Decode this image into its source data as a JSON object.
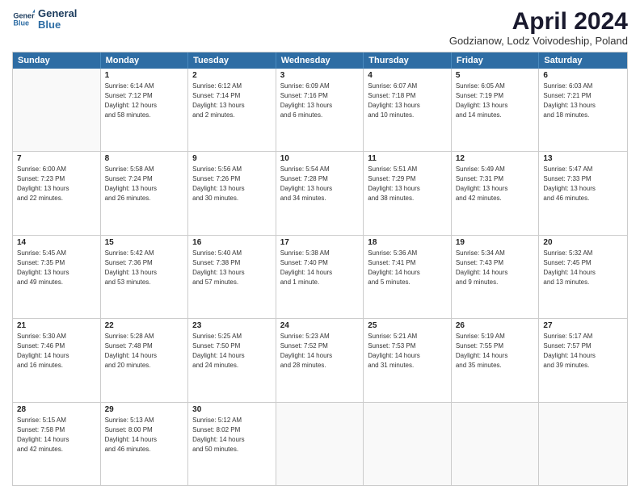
{
  "logo": {
    "line1": "General",
    "line2": "Blue"
  },
  "title": "April 2024",
  "subtitle": "Godzianow, Lodz Voivodeship, Poland",
  "days": [
    "Sunday",
    "Monday",
    "Tuesday",
    "Wednesday",
    "Thursday",
    "Friday",
    "Saturday"
  ],
  "weeks": [
    [
      {
        "day": "",
        "info": ""
      },
      {
        "day": "1",
        "info": "Sunrise: 6:14 AM\nSunset: 7:12 PM\nDaylight: 12 hours\nand 58 minutes."
      },
      {
        "day": "2",
        "info": "Sunrise: 6:12 AM\nSunset: 7:14 PM\nDaylight: 13 hours\nand 2 minutes."
      },
      {
        "day": "3",
        "info": "Sunrise: 6:09 AM\nSunset: 7:16 PM\nDaylight: 13 hours\nand 6 minutes."
      },
      {
        "day": "4",
        "info": "Sunrise: 6:07 AM\nSunset: 7:18 PM\nDaylight: 13 hours\nand 10 minutes."
      },
      {
        "day": "5",
        "info": "Sunrise: 6:05 AM\nSunset: 7:19 PM\nDaylight: 13 hours\nand 14 minutes."
      },
      {
        "day": "6",
        "info": "Sunrise: 6:03 AM\nSunset: 7:21 PM\nDaylight: 13 hours\nand 18 minutes."
      }
    ],
    [
      {
        "day": "7",
        "info": "Sunrise: 6:00 AM\nSunset: 7:23 PM\nDaylight: 13 hours\nand 22 minutes."
      },
      {
        "day": "8",
        "info": "Sunrise: 5:58 AM\nSunset: 7:24 PM\nDaylight: 13 hours\nand 26 minutes."
      },
      {
        "day": "9",
        "info": "Sunrise: 5:56 AM\nSunset: 7:26 PM\nDaylight: 13 hours\nand 30 minutes."
      },
      {
        "day": "10",
        "info": "Sunrise: 5:54 AM\nSunset: 7:28 PM\nDaylight: 13 hours\nand 34 minutes."
      },
      {
        "day": "11",
        "info": "Sunrise: 5:51 AM\nSunset: 7:29 PM\nDaylight: 13 hours\nand 38 minutes."
      },
      {
        "day": "12",
        "info": "Sunrise: 5:49 AM\nSunset: 7:31 PM\nDaylight: 13 hours\nand 42 minutes."
      },
      {
        "day": "13",
        "info": "Sunrise: 5:47 AM\nSunset: 7:33 PM\nDaylight: 13 hours\nand 46 minutes."
      }
    ],
    [
      {
        "day": "14",
        "info": "Sunrise: 5:45 AM\nSunset: 7:35 PM\nDaylight: 13 hours\nand 49 minutes."
      },
      {
        "day": "15",
        "info": "Sunrise: 5:42 AM\nSunset: 7:36 PM\nDaylight: 13 hours\nand 53 minutes."
      },
      {
        "day": "16",
        "info": "Sunrise: 5:40 AM\nSunset: 7:38 PM\nDaylight: 13 hours\nand 57 minutes."
      },
      {
        "day": "17",
        "info": "Sunrise: 5:38 AM\nSunset: 7:40 PM\nDaylight: 14 hours\nand 1 minute."
      },
      {
        "day": "18",
        "info": "Sunrise: 5:36 AM\nSunset: 7:41 PM\nDaylight: 14 hours\nand 5 minutes."
      },
      {
        "day": "19",
        "info": "Sunrise: 5:34 AM\nSunset: 7:43 PM\nDaylight: 14 hours\nand 9 minutes."
      },
      {
        "day": "20",
        "info": "Sunrise: 5:32 AM\nSunset: 7:45 PM\nDaylight: 14 hours\nand 13 minutes."
      }
    ],
    [
      {
        "day": "21",
        "info": "Sunrise: 5:30 AM\nSunset: 7:46 PM\nDaylight: 14 hours\nand 16 minutes."
      },
      {
        "day": "22",
        "info": "Sunrise: 5:28 AM\nSunset: 7:48 PM\nDaylight: 14 hours\nand 20 minutes."
      },
      {
        "day": "23",
        "info": "Sunrise: 5:25 AM\nSunset: 7:50 PM\nDaylight: 14 hours\nand 24 minutes."
      },
      {
        "day": "24",
        "info": "Sunrise: 5:23 AM\nSunset: 7:52 PM\nDaylight: 14 hours\nand 28 minutes."
      },
      {
        "day": "25",
        "info": "Sunrise: 5:21 AM\nSunset: 7:53 PM\nDaylight: 14 hours\nand 31 minutes."
      },
      {
        "day": "26",
        "info": "Sunrise: 5:19 AM\nSunset: 7:55 PM\nDaylight: 14 hours\nand 35 minutes."
      },
      {
        "day": "27",
        "info": "Sunrise: 5:17 AM\nSunset: 7:57 PM\nDaylight: 14 hours\nand 39 minutes."
      }
    ],
    [
      {
        "day": "28",
        "info": "Sunrise: 5:15 AM\nSunset: 7:58 PM\nDaylight: 14 hours\nand 42 minutes."
      },
      {
        "day": "29",
        "info": "Sunrise: 5:13 AM\nSunset: 8:00 PM\nDaylight: 14 hours\nand 46 minutes."
      },
      {
        "day": "30",
        "info": "Sunrise: 5:12 AM\nSunset: 8:02 PM\nDaylight: 14 hours\nand 50 minutes."
      },
      {
        "day": "",
        "info": ""
      },
      {
        "day": "",
        "info": ""
      },
      {
        "day": "",
        "info": ""
      },
      {
        "day": "",
        "info": ""
      }
    ]
  ]
}
